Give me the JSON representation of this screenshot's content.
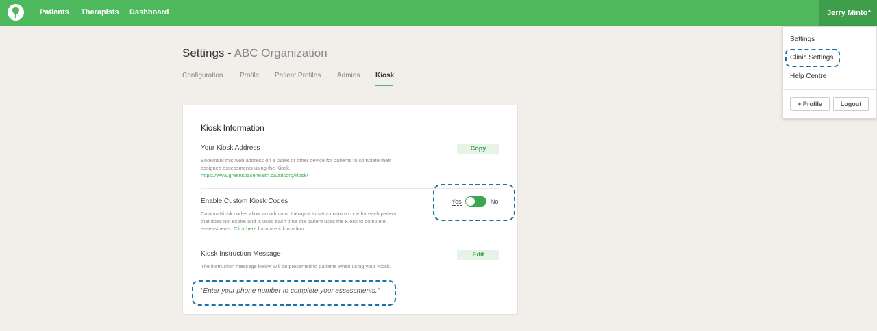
{
  "nav": {
    "links": [
      "Patients",
      "Therapists",
      "Dashboard"
    ],
    "user_name": "Jerry Minto",
    "caret": "▲"
  },
  "user_menu": {
    "items": [
      "Settings",
      "Clinic Settings",
      "Help Centre"
    ],
    "profile_button": "+ Profile",
    "logout_button": "Logout"
  },
  "page": {
    "title": "Settings - ",
    "org": "ABC Organization",
    "tabs": [
      "Configuration",
      "Profile",
      "Patient Profiles",
      "Admins",
      "Kiosk"
    ],
    "active_tab": "Kiosk"
  },
  "kiosk": {
    "card_title": "Kiosk Information",
    "address": {
      "title": "Your Kiosk Address",
      "description": "Bookmark this web address on a tablet or other device for patients to complete their assigned assessments using the Kiosk.",
      "url": "https://www.greenspacehealth.ca/abcorg/kiosk/",
      "button": "Copy"
    },
    "custom_codes": {
      "title": "Enable Custom Kiosk Codes",
      "description": "Custom Kiosk codes allow an admin or therapist to set a custom code for each patient, that does not expire and is used each time the patient uses the Kiosk to complete assessments. ",
      "link_text": "Click here",
      "description_tail": " for more information.",
      "yes_label": "Yes",
      "no_label": "No",
      "enabled": true
    },
    "instruction": {
      "title": "Kiosk Instruction Message",
      "description": "The instruction message below will be presented to patients when using your Kiosk.",
      "message": "\"Enter your phone number to complete your assessments.\"",
      "button": "Edit"
    }
  },
  "colors": {
    "brand_green": "#4db85c",
    "highlight": "#1a73a8"
  }
}
